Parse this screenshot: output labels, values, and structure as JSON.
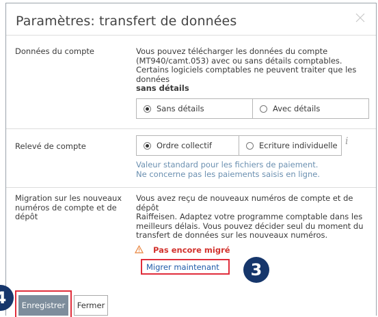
{
  "dialog": {
    "title": "Paramètres: transfert de données",
    "close_icon": "close-icon"
  },
  "account_data": {
    "label": "Données du compte",
    "desc_line1": "Vous pouvez télécharger les données du compte",
    "desc_line2": "(MT940/camt.053) avec ou sans détails comptables.",
    "desc_line3": "Certains logiciels comptables ne peuvent traiter que les données",
    "desc_bold": "sans détails",
    "options": [
      {
        "label": "Sans détails",
        "selected": true
      },
      {
        "label": "Avec détails",
        "selected": false
      }
    ]
  },
  "statement": {
    "label": "Relevé de compte",
    "options": [
      {
        "label": "Ordre collectif",
        "selected": true
      },
      {
        "label": "Ecriture individuelle",
        "selected": false
      }
    ],
    "info_icon": "info-icon",
    "hint_line1": "Valeur standard pour les fichiers de paiement.",
    "hint_line2": "Ne concerne pas les paiements saisis en ligne."
  },
  "migration": {
    "label_line1": "Migration sur les nouveaux",
    "label_line2": "numéros de compte et de",
    "label_line3": "dépôt",
    "desc_line1": "Vous avez reçu de nouveaux numéros de compte et de dépôt",
    "desc_line2": "Raiffeisen. Adaptez votre programme comptable dans les",
    "desc_line3": "meilleurs délais. Vous pouvez décider seul du moment du",
    "desc_line4": "transfert de données sur les nouveaux numéros.",
    "status": "Pas encore migré",
    "status_icon": "warning-icon",
    "action": "Migrer maintenant"
  },
  "footer": {
    "save_label": "Enregistrer",
    "close_label": "Fermer"
  },
  "annotations": {
    "step3": "3",
    "step4": "4"
  },
  "colors": {
    "accent_red": "#e02c3a",
    "badge_navy": "#16366b",
    "link_blue": "#1e5aa8",
    "warning_red": "#d2322d"
  }
}
